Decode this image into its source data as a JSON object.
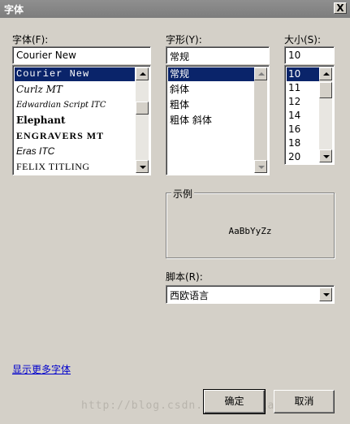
{
  "window": {
    "title": "字体",
    "close_label": "X"
  },
  "font": {
    "label": "字体(F):",
    "value": "Courier New",
    "items": [
      "Courier New",
      "Curlz MT",
      "Edwardian Script ITC",
      "Elephant",
      "ENGRAVERS MT",
      "Eras ITC",
      "FELIX TITLING"
    ],
    "selected": "Courier New"
  },
  "style": {
    "label": "字形(Y):",
    "value": "常规",
    "items": [
      "常规",
      "斜体",
      "粗体",
      "粗体 斜体"
    ],
    "selected": "常规"
  },
  "size": {
    "label": "大小(S):",
    "value": "10",
    "items": [
      "10",
      "11",
      "12",
      "14",
      "16",
      "18",
      "20"
    ],
    "selected": "10"
  },
  "sample": {
    "legend": "示例",
    "text": "AaBbYyZz"
  },
  "script": {
    "label": "脚本(R):",
    "value": "西欧语言"
  },
  "more_fonts_link": "显示更多字体",
  "buttons": {
    "ok": "确定",
    "cancel": "取消"
  },
  "watermark": "http://blog.csdn.net/maoxian1232"
}
